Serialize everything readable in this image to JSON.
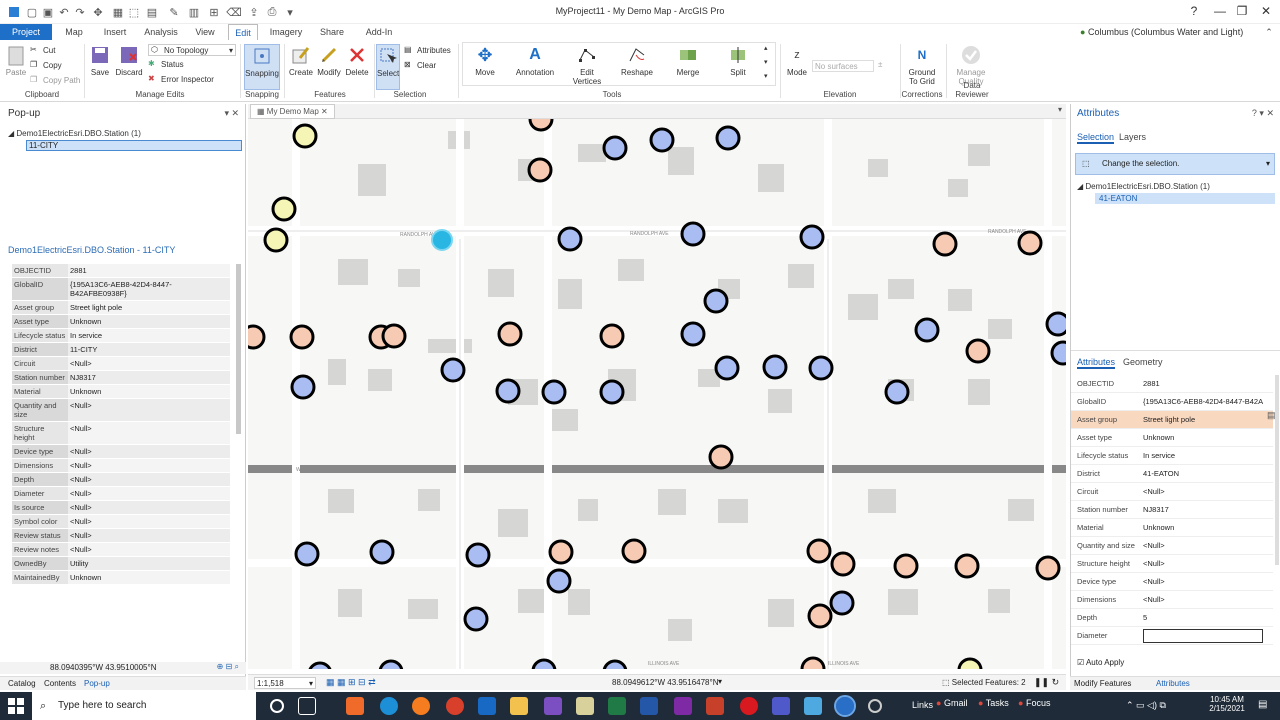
{
  "window": {
    "title": "MyProject11 - My Demo Map - ArcGIS Pro",
    "help": "?",
    "minimize": "—",
    "restore": "❐",
    "close": "✕"
  },
  "portal": "Columbus (Columbus Water and Light) ▾",
  "tabs": [
    "Project",
    "Map",
    "Insert",
    "Analysis",
    "View",
    "Edit",
    "Imagery",
    "Share",
    "Add-In"
  ],
  "ribbon": {
    "clipboard": {
      "paste": "Paste",
      "cut": "Cut",
      "copy": "Copy",
      "copy_path": "Copy Path",
      "label": "Clipboard"
    },
    "manage_edits": {
      "save": "Save",
      "discard": "Discard",
      "topology": "No Topology",
      "status": "Status",
      "error_inspector": "Error Inspector",
      "label": "Manage Edits"
    },
    "snapping": {
      "snapping": "Snapping",
      "label": "Snapping"
    },
    "features": {
      "create": "Create",
      "modify": "Modify",
      "delete": "Delete",
      "label": "Features"
    },
    "selection": {
      "select": "Select",
      "attributes": "Attributes",
      "clear": "Clear",
      "label": "Selection"
    },
    "tools": {
      "move": "Move",
      "annotation": "Annotation",
      "edit_vertices": "Edit Vertices",
      "reshape": "Reshape",
      "merge": "Merge",
      "split": "Split",
      "label": "Tools"
    },
    "elevation": {
      "mode": "Mode",
      "surfaces": "No surfaces",
      "label": "Elevation"
    },
    "corrections": {
      "ground": "Ground To Grid",
      "label": "Corrections"
    },
    "data_reviewer": {
      "manage": "Manage Quality",
      "label": "Data Reviewer"
    }
  },
  "popup": {
    "title": "Pop-up",
    "layer": "Demo1ElectricEsri.DBO.Station  (1)",
    "feature": "11-CITY",
    "header": "Demo1ElectricEsri.DBO.Station - 11-CITY",
    "rows": [
      {
        "k": "OBJECTID",
        "v": "2881"
      },
      {
        "k": "GlobalID",
        "v": "{195A13C6-AEB8-42D4-8447-B42AFBE0938F}"
      },
      {
        "k": "Asset group",
        "v": "Street light pole"
      },
      {
        "k": "Asset type",
        "v": "Unknown"
      },
      {
        "k": "Lifecycle status",
        "v": "In service"
      },
      {
        "k": "District",
        "v": "11-CITY"
      },
      {
        "k": "Circuit",
        "v": "<Null>"
      },
      {
        "k": "Station number",
        "v": "NJ8317"
      },
      {
        "k": "Material",
        "v": "Unknown"
      },
      {
        "k": "Quantity and size",
        "v": "<Null>"
      },
      {
        "k": "Structure height",
        "v": "<Null>"
      },
      {
        "k": "Device type",
        "v": "<Null>"
      },
      {
        "k": "Dimensions",
        "v": "<Null>"
      },
      {
        "k": "Depth",
        "v": "<Null>"
      },
      {
        "k": "Diameter",
        "v": "<Null>"
      },
      {
        "k": "Is source",
        "v": "<Null>"
      },
      {
        "k": "Symbol color",
        "v": "<Null>"
      },
      {
        "k": "Review status",
        "v": "<Null>"
      },
      {
        "k": "Review notes",
        "v": "<Null>"
      },
      {
        "k": "OwnedBy",
        "v": "Utility"
      },
      {
        "k": "MaintainedBy",
        "v": "Unknown"
      }
    ],
    "coords": "88.0940395°W 43.9510005°N"
  },
  "bottom_tabs": [
    "Catalog",
    "Contents",
    "Pop-up"
  ],
  "map": {
    "tab": "My Demo Map",
    "scale": "1:1,518",
    "coords": "88.0949612°W 43.9516478°N",
    "selected": "Selected Features: 2",
    "streets": [
      "RANDOLPH AVE",
      "WISCONSIN AVE",
      "ILLINOIS AVE"
    ]
  },
  "attributes": {
    "title": "Attributes",
    "tabs": [
      "Selection",
      "Layers"
    ],
    "change_selection": "Change the selection.",
    "layer": "Demo1ElectricEsri.DBO.Station (1)",
    "feature": "41-EATON",
    "subtabs": [
      "Attributes",
      "Geometry"
    ],
    "rows": [
      {
        "k": "OBJECTID",
        "v": "2881"
      },
      {
        "k": "GlobalID",
        "v": "{195A13C6-AEB8-42D4-8447-B42A"
      },
      {
        "k": "Asset group",
        "v": "Street light pole"
      },
      {
        "k": "Asset type",
        "v": "Unknown"
      },
      {
        "k": "Lifecycle status",
        "v": "In service"
      },
      {
        "k": "District",
        "v": "41-EATON"
      },
      {
        "k": "Circuit",
        "v": "<Null>"
      },
      {
        "k": "Station number",
        "v": "NJ8317"
      },
      {
        "k": "Material",
        "v": "Unknown"
      },
      {
        "k": "Quantity and size",
        "v": "<Null>"
      },
      {
        "k": "Structure height",
        "v": "<Null>"
      },
      {
        "k": "Device type",
        "v": "<Null>"
      },
      {
        "k": "Dimensions",
        "v": "<Null>"
      },
      {
        "k": "Depth",
        "v": "5"
      },
      {
        "k": "Diameter",
        "v": ""
      }
    ],
    "auto_apply": "Auto Apply",
    "footer_tabs": [
      "Modify Features",
      "Attributes"
    ]
  },
  "taskbar": {
    "search": "Type here to search",
    "links": "Links",
    "gmail": "Gmail",
    "tasks": "Tasks",
    "focus": "Focus",
    "time": "10:45 AM",
    "date": "2/15/2021"
  },
  "colors": {
    "accent": "#1e6fc8",
    "light_blue": "#a9bdf2",
    "peach": "#f7cbb3",
    "yellow": "#f5f6b5",
    "selected": "#29b6e3",
    "highlight": "#f9d8c0"
  }
}
